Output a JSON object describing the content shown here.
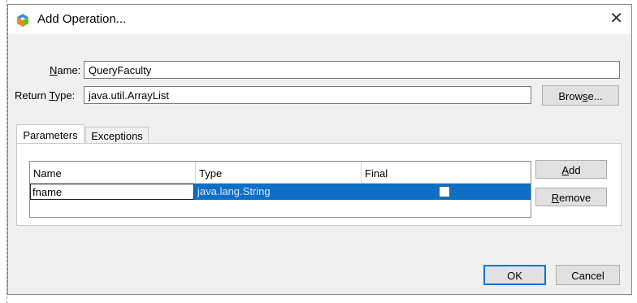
{
  "dialog": {
    "title": "Add Operation...",
    "close_glyph": "✕",
    "icon": "netbeans-cube-icon"
  },
  "form": {
    "name_label_pre": "",
    "name_label_ul": "N",
    "name_label_post": "ame:",
    "name_value": "QueryFaculty",
    "return_label_pre": "Return ",
    "return_label_ul": "T",
    "return_label_post": "ype:",
    "return_value": "java.util.ArrayList",
    "browse_pre": "Brow",
    "browse_ul": "s",
    "browse_post": "e..."
  },
  "tabs": [
    {
      "label": "Parameters",
      "active": true
    },
    {
      "label": "Exceptions",
      "active": false
    }
  ],
  "table": {
    "columns": [
      "Name",
      "Type",
      "Final"
    ],
    "rows": [
      {
        "name": "fname",
        "type": "java.lang.String",
        "final": false
      }
    ]
  },
  "side_buttons": {
    "add_ul": "A",
    "add_post": "dd",
    "remove_ul": "R",
    "remove_post": "emove"
  },
  "footer": {
    "ok": "OK",
    "cancel": "Cancel"
  },
  "colors": {
    "selection": "#0f6fc6",
    "default_button_border": "#0078d7"
  }
}
